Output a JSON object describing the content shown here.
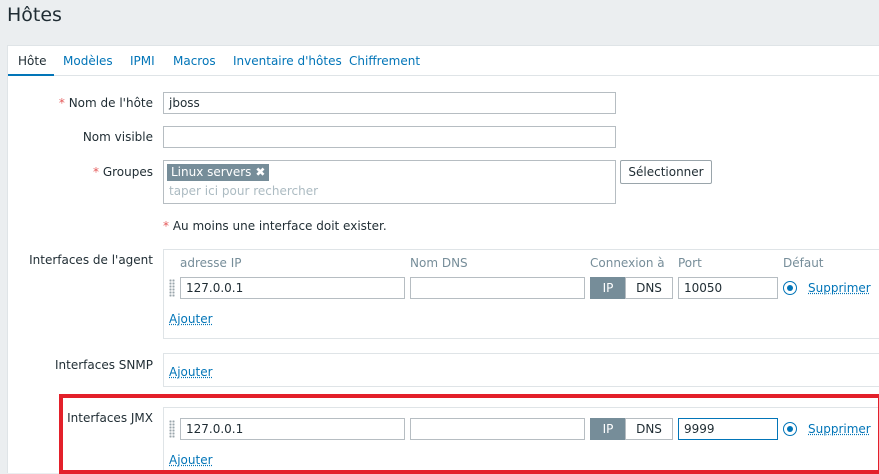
{
  "page": {
    "title": "Hôtes"
  },
  "tabs": [
    {
      "label": "Hôte"
    },
    {
      "label": "Modèles"
    },
    {
      "label": "IPMI"
    },
    {
      "label": "Macros"
    },
    {
      "label": "Inventaire d'hôtes"
    },
    {
      "label": "Chiffrement"
    }
  ],
  "form": {
    "required_marker": "*",
    "host_name": {
      "label": "Nom de l'hôte",
      "value": "jboss"
    },
    "visible_name": {
      "label": "Nom visible",
      "value": ""
    },
    "groups": {
      "label": "Groupes",
      "chips": [
        {
          "label": "Linux servers",
          "remove_icon": "close-icon"
        }
      ],
      "placeholder": "taper ici pour rechercher",
      "select_button": "Sélectionner"
    },
    "interface_note": "Au moins une interface doit exister.",
    "agent_interfaces": {
      "label": "Interfaces de l'agent",
      "columns": {
        "ip": "adresse IP",
        "dns": "Nom DNS",
        "connect": "Connexion à",
        "port": "Port",
        "default": "Défaut"
      },
      "row": {
        "ip": "127.0.0.1",
        "dns": "",
        "ip_btn": "IP",
        "dns_btn": "DNS",
        "port": "10050",
        "remove": "Supprimer"
      },
      "add": "Ajouter"
    },
    "snmp_interfaces": {
      "label": "Interfaces SNMP",
      "add": "Ajouter"
    },
    "jmx_interfaces": {
      "label": "Interfaces JMX",
      "row": {
        "ip": "127.0.0.1",
        "dns": "",
        "ip_btn": "IP",
        "dns_btn": "DNS",
        "port": "9999",
        "remove": "Supprimer"
      },
      "add": "Ajouter"
    }
  },
  "colors": {
    "accent": "#0275b8",
    "highlight": "#e3202a",
    "required": "#e45959"
  }
}
